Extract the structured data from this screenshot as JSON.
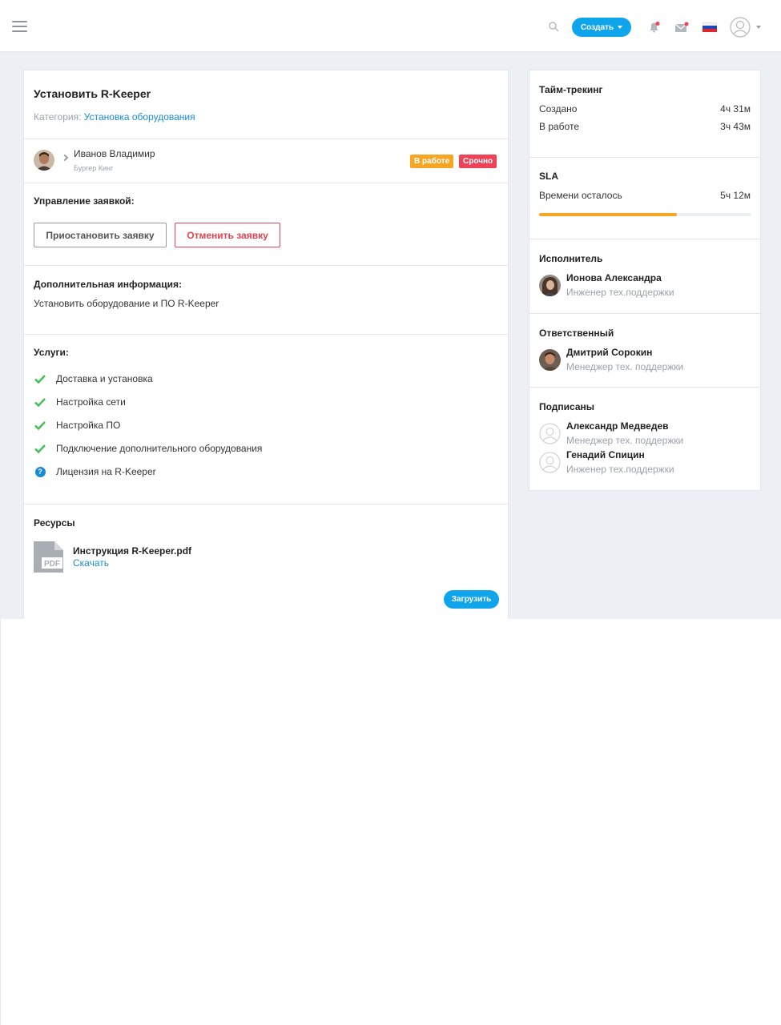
{
  "header": {
    "create_label": "Создать",
    "menu_icon": "hamburger-icon",
    "search_icon": "search-icon",
    "notifications_icon": "bell-icon",
    "mail_icon": "mail-icon",
    "language_icon": "russian-flag-icon",
    "profile_icon": "user-icon"
  },
  "ticket": {
    "title": "Установить R-Keeper",
    "category_label": "Категория:",
    "category_value": "Установка оборудования",
    "client_name": "Иванов Владимир",
    "client_company": "Бургер Кинг",
    "status_badge": "В работе",
    "priority_badge": "Срочно"
  },
  "management": {
    "heading": "Управление заявкой:",
    "pause_label": "Приостановить заявку",
    "cancel_label": "Отменить заявку"
  },
  "additional": {
    "heading": "Дополнительная информация:",
    "text": "Установить оборудование и ПО R-Keeper"
  },
  "services": {
    "heading": "Услуги:",
    "items": [
      {
        "label": "Доставка и установка",
        "state": "done"
      },
      {
        "label": "Настройка сети",
        "state": "done"
      },
      {
        "label": "Настройка ПО",
        "state": "done"
      },
      {
        "label": "Подключение дополнительного оборудования",
        "state": "done"
      },
      {
        "label": "Лицензия на R-Keeper",
        "state": "question"
      }
    ]
  },
  "resources": {
    "heading": "Ресурсы",
    "file_name": "Инструкция R-Keeper.pdf",
    "download_label": "Скачать",
    "upload_label": "Загрузить"
  },
  "time_tracking": {
    "heading": "Тайм-трекинг",
    "created_label": "Создано",
    "created_value": "4ч 31м",
    "in_work_label": "В работе",
    "in_work_value": "3ч 43м"
  },
  "sla": {
    "heading": "SLA",
    "remaining_label": "Времени осталось",
    "remaining_value": "5ч 12м",
    "progress_fraction": 0.65
  },
  "executor": {
    "heading": "Исполнитель",
    "name": "Ионова Александра",
    "role": "Инженер тех.поддержки"
  },
  "responsible": {
    "heading": "Ответственный",
    "name": "Дмитрий Сорокин",
    "role": "Менеджер тех. поддержки"
  },
  "subscribers": {
    "heading": "Подписаны",
    "people": [
      {
        "name": "Александр Медведев",
        "role": "Менеджер тех. поддержки"
      },
      {
        "name": "Генадий Спицин",
        "role": "Инженер тех.поддержки"
      }
    ]
  },
  "colors": {
    "accent": "#0fa5ec",
    "in_work": "#f6a623",
    "urgent": "#ef4256",
    "check": "#3fbf55",
    "link": "#1a8ad6"
  }
}
